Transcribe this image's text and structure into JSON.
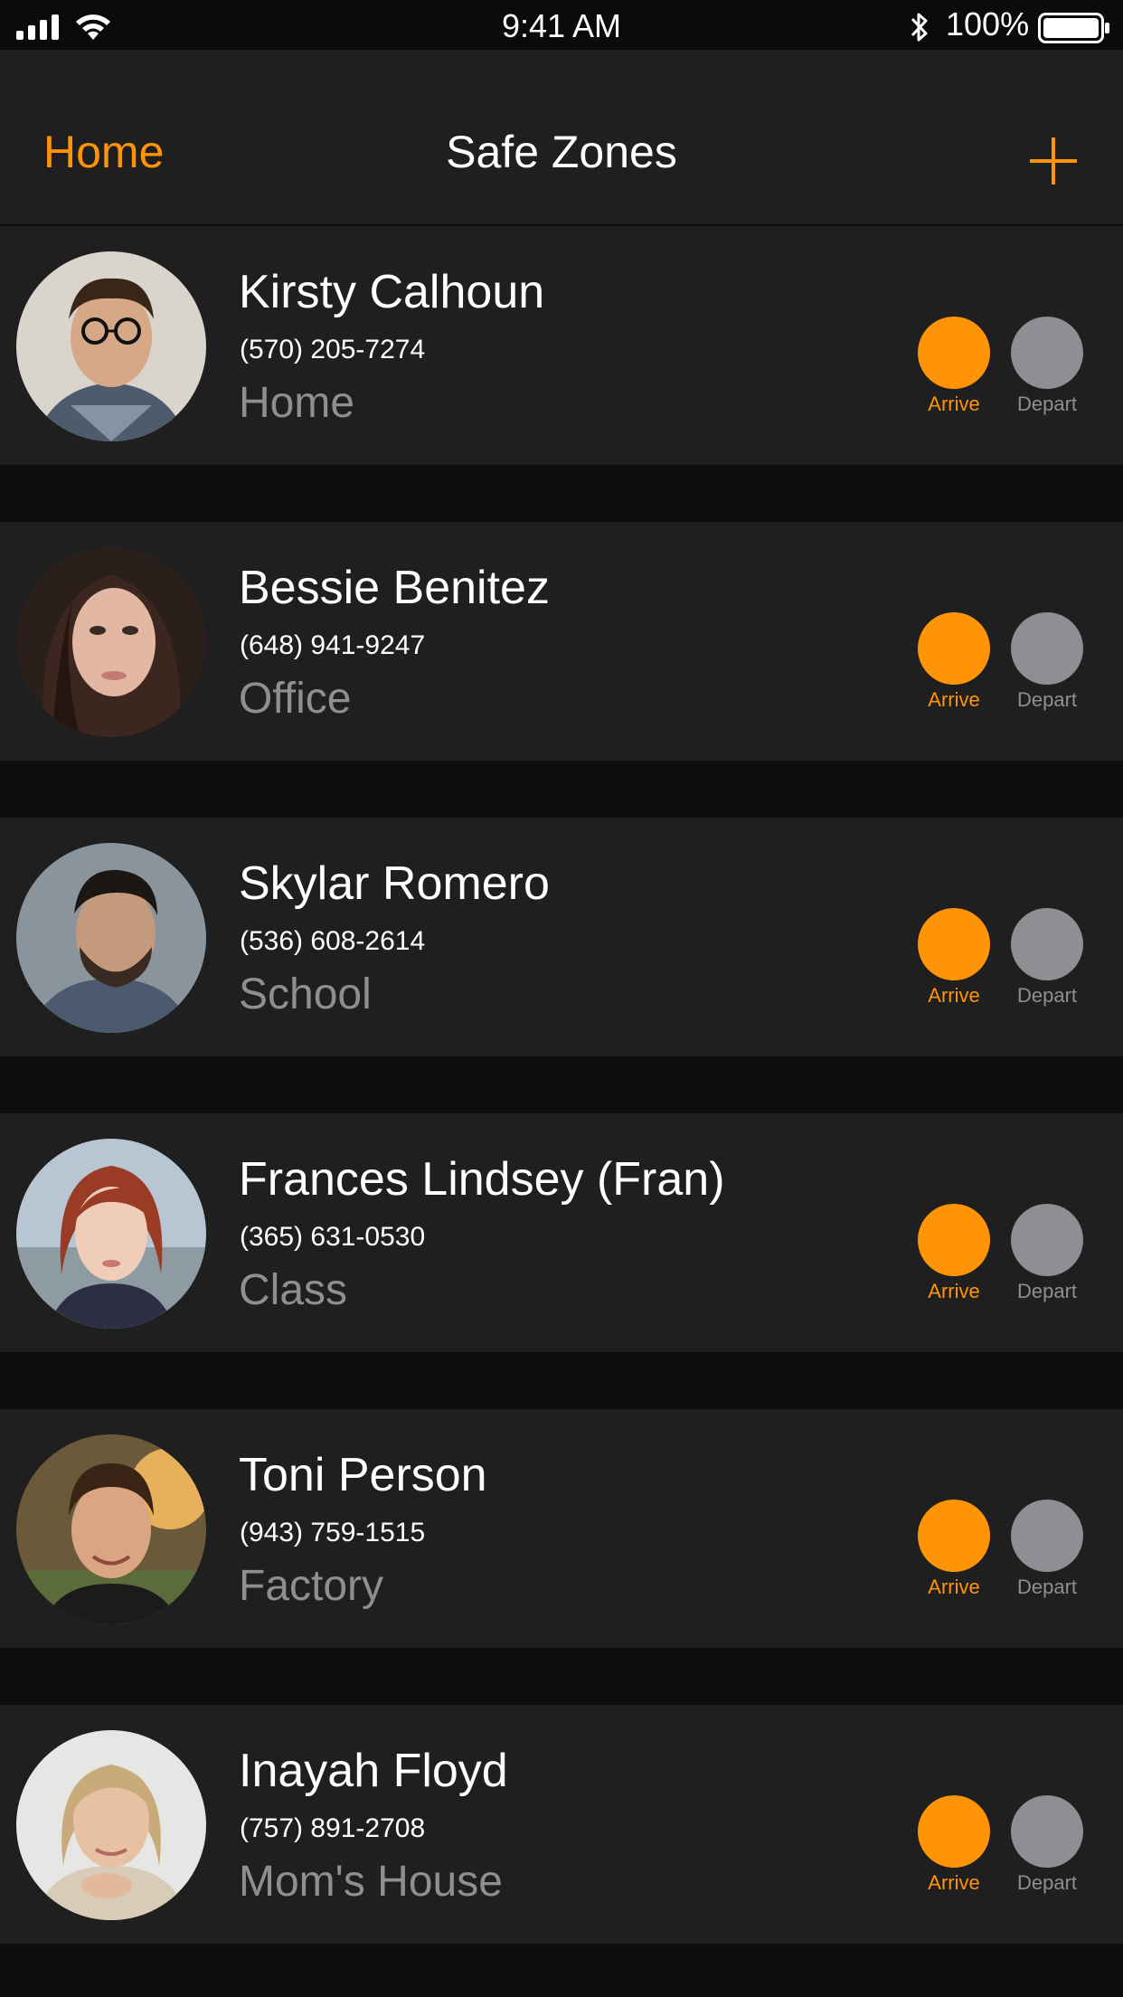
{
  "status_bar": {
    "time": "9:41 AM",
    "battery_percent": "100%",
    "icons": [
      "signal-icon",
      "wifi-icon",
      "bluetooth-icon",
      "battery-icon"
    ]
  },
  "nav": {
    "back_label": "Home",
    "title": "Safe Zones",
    "add_icon": "plus-icon"
  },
  "colors": {
    "accent": "#ff9408",
    "inactive": "#8e8e93",
    "row_bg": "#1f1f1f",
    "page_bg": "#0e0e0e"
  },
  "contacts": [
    {
      "name": "Kirsty Calhoun",
      "phone": "(570) 205-7274",
      "zone": "Home",
      "arrive_label": "Arrive",
      "depart_label": "Depart",
      "arrive_on": true,
      "depart_on": false
    },
    {
      "name": "Bessie Benitez",
      "phone": "(648) 941-9247",
      "zone": "Office",
      "arrive_label": "Arrive",
      "depart_label": "Depart",
      "arrive_on": true,
      "depart_on": false
    },
    {
      "name": "Skylar Romero",
      "phone": "(536) 608-2614",
      "zone": "School",
      "arrive_label": "Arrive",
      "depart_label": "Depart",
      "arrive_on": true,
      "depart_on": false
    },
    {
      "name": "Frances Lindsey (Fran)",
      "phone": "(365) 631-0530",
      "zone": "Class",
      "arrive_label": "Arrive",
      "depart_label": "Depart",
      "arrive_on": true,
      "depart_on": false
    },
    {
      "name": "Toni Person",
      "phone": "(943) 759-1515",
      "zone": "Factory",
      "arrive_label": "Arrive",
      "depart_label": "Depart",
      "arrive_on": true,
      "depart_on": false
    },
    {
      "name": "Inayah Floyd",
      "phone": "(757) 891-2708",
      "zone": "Mom's House",
      "arrive_label": "Arrive",
      "depart_label": "Depart",
      "arrive_on": true,
      "depart_on": false
    }
  ]
}
